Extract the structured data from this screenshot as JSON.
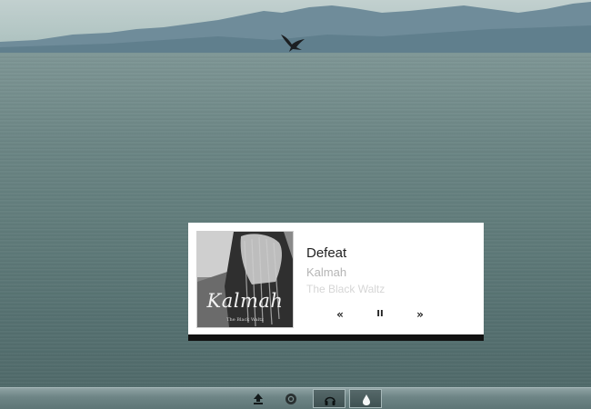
{
  "player": {
    "track_title": "Defeat",
    "artist": "Kalmah",
    "album": "The Black Waltz",
    "album_art_logo": "Kalmah",
    "album_art_subtitle": "The Black Waltz",
    "controls": {
      "previous_icon": "«",
      "pause_icon": "II",
      "next_icon": "»"
    }
  },
  "taskbar": {
    "items": [
      {
        "icon": "upload-icon",
        "active": false
      },
      {
        "icon": "chrome-icon",
        "active": false
      },
      {
        "icon": "headphones-icon",
        "active": true
      },
      {
        "icon": "droplet-icon",
        "active": true
      }
    ]
  },
  "colors": {
    "widget_background": "#ffffff",
    "title_text": "#222222",
    "artist_text": "#b5b5b5",
    "album_text": "#d6d6d6",
    "taskbar": "#6e8586"
  }
}
